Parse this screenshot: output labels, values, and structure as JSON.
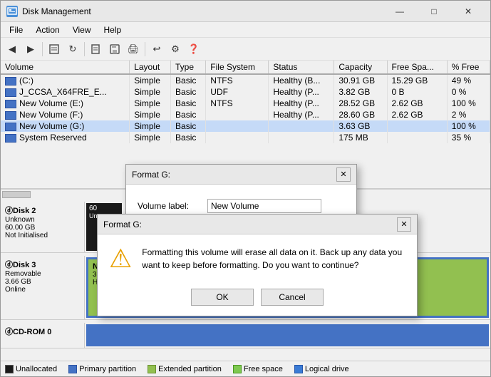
{
  "window": {
    "title": "Disk Management",
    "controls": {
      "minimize": "—",
      "maximize": "□",
      "close": "✕"
    }
  },
  "menu": {
    "items": [
      "File",
      "Action",
      "View",
      "Help"
    ]
  },
  "toolbar": {
    "buttons": [
      "◀",
      "▶",
      "📋",
      "🔄",
      "📄",
      "💾",
      "🖨",
      "🗑",
      "⚙",
      "❓"
    ]
  },
  "table": {
    "headers": [
      "Volume",
      "Layout",
      "Type",
      "File System",
      "Status",
      "Capacity",
      "Free Spa...",
      "% Free"
    ],
    "rows": [
      [
        "(C:)",
        "Simple",
        "Basic",
        "NTFS",
        "Healthy (B...",
        "30.91 GB",
        "15.29 GB",
        "49 %"
      ],
      [
        "J_CCSA_X64FRE_E...",
        "Simple",
        "Basic",
        "UDF",
        "Healthy (P...",
        "3.82 GB",
        "0 B",
        "0 %"
      ],
      [
        "New Volume (E:)",
        "Simple",
        "Basic",
        "NTFS",
        "Healthy (P...",
        "28.52 GB",
        "2.62 GB",
        "100 %"
      ],
      [
        "New Volume (F:)",
        "Simple",
        "Basic",
        "",
        "Healthy (P...",
        "28.60 GB",
        "2.62 GB",
        "2 %"
      ],
      [
        "New Volume (G:)",
        "Simple",
        "Basic",
        "",
        "",
        "3.63 GB",
        "",
        "100 %"
      ],
      [
        "System Reserved",
        "Simple",
        "Basic",
        "",
        "",
        "175 MB",
        "",
        "35 %"
      ]
    ]
  },
  "format_dialog_bg": {
    "title": "Format G:",
    "volume_label_label": "Volume label:",
    "volume_label_value": "New Volume"
  },
  "warning_dialog": {
    "title": "Format G:",
    "message": "Formatting this volume will erase all data on it. Back up any data you want to keep before formatting. Do you want to continue?",
    "ok_label": "OK",
    "cancel_label": "Cancel"
  },
  "disks": [
    {
      "name": "Disk 2",
      "type": "Unknown",
      "size": "60.00 GB",
      "status": "Not Initialised",
      "partitions": [
        {
          "style": "small-black",
          "label": "60",
          "sub": "Un"
        }
      ]
    },
    {
      "name": "Disk 3",
      "type": "Removable",
      "size": "3.66 GB",
      "status": "Online",
      "partitions": [
        {
          "style": "green-selected",
          "label": "New Volume (G:)",
          "sub1": "3.65 GB NTFS",
          "sub2": "Healthy (Logical Drive)"
        }
      ]
    },
    {
      "name": "CD-ROM 0",
      "type": "",
      "size": "",
      "status": "",
      "partitions": []
    }
  ],
  "legend": [
    {
      "color": "#1a1a1a",
      "label": "Unallocated"
    },
    {
      "color": "#4472c4",
      "label": "Primary partition"
    },
    {
      "color": "#92c050",
      "label": "Extended partition"
    },
    {
      "color": "#7ec850",
      "label": "Free space"
    },
    {
      "color": "#3a7bd5",
      "label": "Logical drive"
    }
  ]
}
